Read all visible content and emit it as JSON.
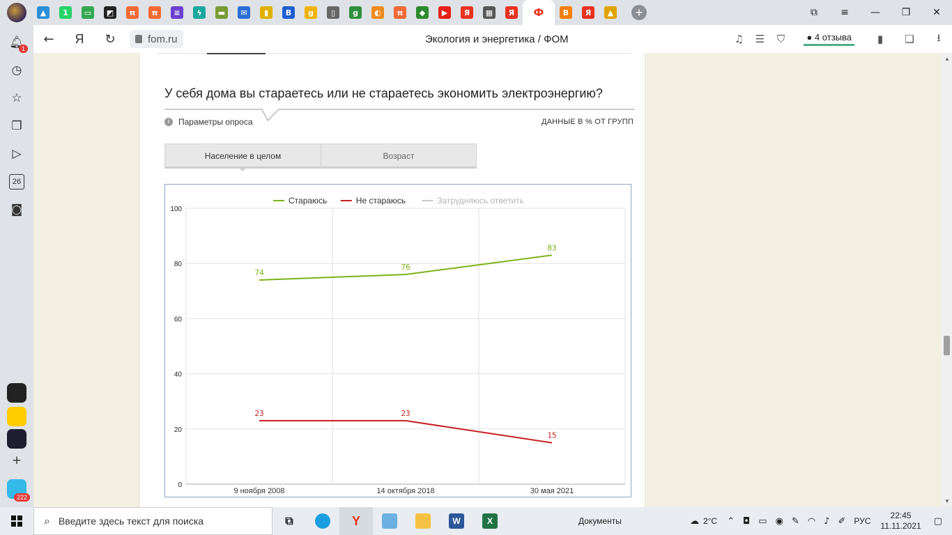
{
  "browser": {
    "url": "fom.ru",
    "page_title": "Экология и энергетика / ФОМ",
    "reviews": "4 отзыва",
    "sidebar_badge_notifications": "1",
    "sidebar_calendar_day": "26",
    "sidebar_app_badge": "222"
  },
  "tabs": [
    {
      "icon": "image-icon",
      "color": "#2a8fd8",
      "glyph": "▲"
    },
    {
      "icon": "whatsapp-icon",
      "color": "#25d366",
      "glyph": "1"
    },
    {
      "icon": "chat-icon",
      "color": "#33a852",
      "glyph": "▭"
    },
    {
      "icon": "grid-logo-icon",
      "color": "#222",
      "glyph": "◩"
    },
    {
      "icon": "pi-icon",
      "color": "#f26a35",
      "glyph": "π"
    },
    {
      "icon": "pi-icon",
      "color": "#f26a35",
      "glyph": "π"
    },
    {
      "icon": "list-icon",
      "color": "#6a3fd1",
      "glyph": "≡"
    },
    {
      "icon": "lightning-icon",
      "color": "#1aa89c",
      "glyph": "ϟ"
    },
    {
      "icon": "book-icon",
      "color": "#7a9b35",
      "glyph": "▬"
    },
    {
      "icon": "mail-icon",
      "color": "#2b6fd6",
      "glyph": "✉"
    },
    {
      "icon": "bookmark-icon",
      "color": "#e0b000",
      "glyph": "▮"
    },
    {
      "icon": "b-letter-icon",
      "color": "#1d5fd2",
      "glyph": "B"
    },
    {
      "icon": "g-letter-icon",
      "color": "#f2b200",
      "glyph": "g"
    },
    {
      "icon": "document-icon",
      "color": "#666",
      "glyph": "▯"
    },
    {
      "icon": "gb-icon",
      "color": "#2f8f3a",
      "glyph": "g"
    },
    {
      "icon": "globe-icon",
      "color": "#f08a1c",
      "glyph": "◐"
    },
    {
      "icon": "pi-icon",
      "color": "#f26a35",
      "glyph": "π"
    },
    {
      "icon": "diamond-icon",
      "color": "#2f8a2f",
      "glyph": "◆"
    },
    {
      "icon": "youtube-icon",
      "color": "#e62117",
      "glyph": "▶"
    },
    {
      "icon": "yandex-icon",
      "color": "#e8321f",
      "glyph": "Я"
    },
    {
      "icon": "pattern-icon",
      "color": "#555",
      "glyph": "▦"
    },
    {
      "icon": "yandex-icon",
      "color": "#e8321f",
      "glyph": "Я"
    },
    {
      "icon": "fom-icon",
      "color": "#e8321f",
      "glyph": "Ф"
    },
    {
      "icon": "blogger-icon",
      "color": "#f57d00",
      "glyph": "B"
    },
    {
      "icon": "yandex-icon",
      "color": "#e8321f",
      "glyph": "Я"
    },
    {
      "icon": "picture-icon",
      "color": "#e0a400",
      "glyph": "▲"
    }
  ],
  "survey": {
    "question": "У себя дома вы стараетесь или не стараетесь экономить электроэнергию?",
    "params_label": "Параметры опроса",
    "data_note": "ДАННЫЕ В % ОТ ГРУПП",
    "tab_population": "Население в целом",
    "tab_age": "Возраст"
  },
  "chart_data": {
    "type": "line",
    "categories": [
      "9 ноября 2008",
      "14 октября 2018",
      "30 мая 2021"
    ],
    "series": [
      {
        "name": "Стараюсь",
        "color": "#7ab317",
        "values": [
          74,
          76,
          83
        ],
        "visible": true
      },
      {
        "name": "Не стараюсь",
        "color": "#c81e1e",
        "values": [
          23,
          23,
          15
        ],
        "visible": true
      },
      {
        "name": "Затрудняюсь ответить",
        "color": "#c8c8c8",
        "values": [],
        "visible": false
      }
    ],
    "ylim": [
      0,
      100
    ],
    "yticks": [
      0,
      20,
      40,
      60,
      80,
      100
    ],
    "grid": true,
    "legend": "top-center",
    "data_labels": true
  },
  "taskbar": {
    "search_placeholder": "Введите здесь текст для поиска",
    "docs_label": "Документы",
    "weather": "2°C",
    "lang": "РУС",
    "time": "22:45",
    "date": "11.11.2021"
  }
}
